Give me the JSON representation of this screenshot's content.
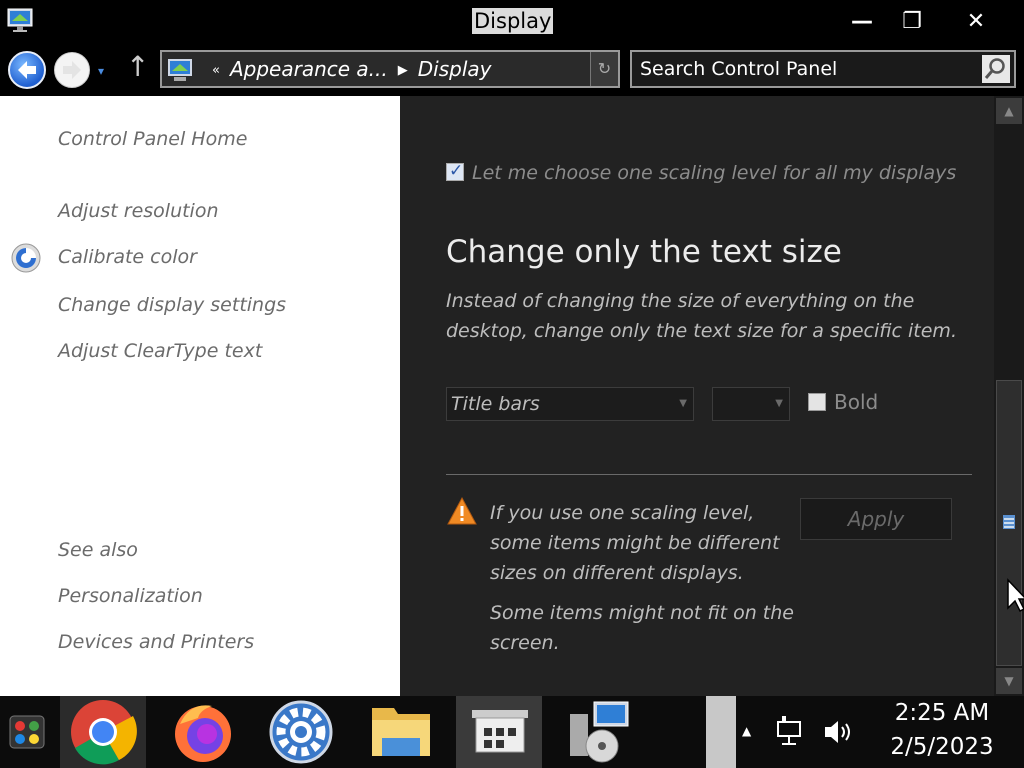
{
  "window": {
    "title": "Display",
    "minimize_label": "—",
    "maximize_label": "❐",
    "close_label": "✕"
  },
  "nav": {
    "breadcrumbs": [
      "Appearance a...",
      "Display"
    ],
    "breadcrumb_prefix": "«",
    "search_placeholder": "Search Control Panel",
    "up_label": "↑",
    "refresh_label": "↻",
    "dropdown_label": "▾"
  },
  "sidebar": {
    "home": "Control Panel Home",
    "links": [
      "Adjust resolution",
      "Calibrate color",
      "Change display settings",
      "Adjust ClearType text"
    ],
    "see_also_heading": "See also",
    "see_also": [
      "Personalization",
      "Devices and Printers"
    ]
  },
  "main": {
    "scaling_checkbox_label": "Let me choose one scaling level for all my displays",
    "scaling_checkbox_checked": true,
    "heading": "Change only the text size",
    "description": "Instead of changing the size of everything on the desktop, change only the text size for a specific item.",
    "item_select_value": "Title bars",
    "size_select_value": "",
    "bold_label": "Bold",
    "bold_checked": false,
    "warning_text_1": "If you use one scaling level, some items might be different sizes on different displays.",
    "warning_text_2": "Some items might not fit on the screen.",
    "apply_label": "Apply"
  },
  "taskbar": {
    "apps": [
      "color-palette-icon",
      "chrome-icon",
      "firefox-icon",
      "settings-gear-icon",
      "file-explorer-icon",
      "control-panel-icon",
      "media-setup-icon"
    ],
    "time": "2:25 AM",
    "date": "2/5/2023"
  },
  "colors": {
    "main_bg": "#222222",
    "sidebar_bg": "#ffffff",
    "accent_blue": "#1f5fd0",
    "warning_orange": "#f08a24"
  }
}
